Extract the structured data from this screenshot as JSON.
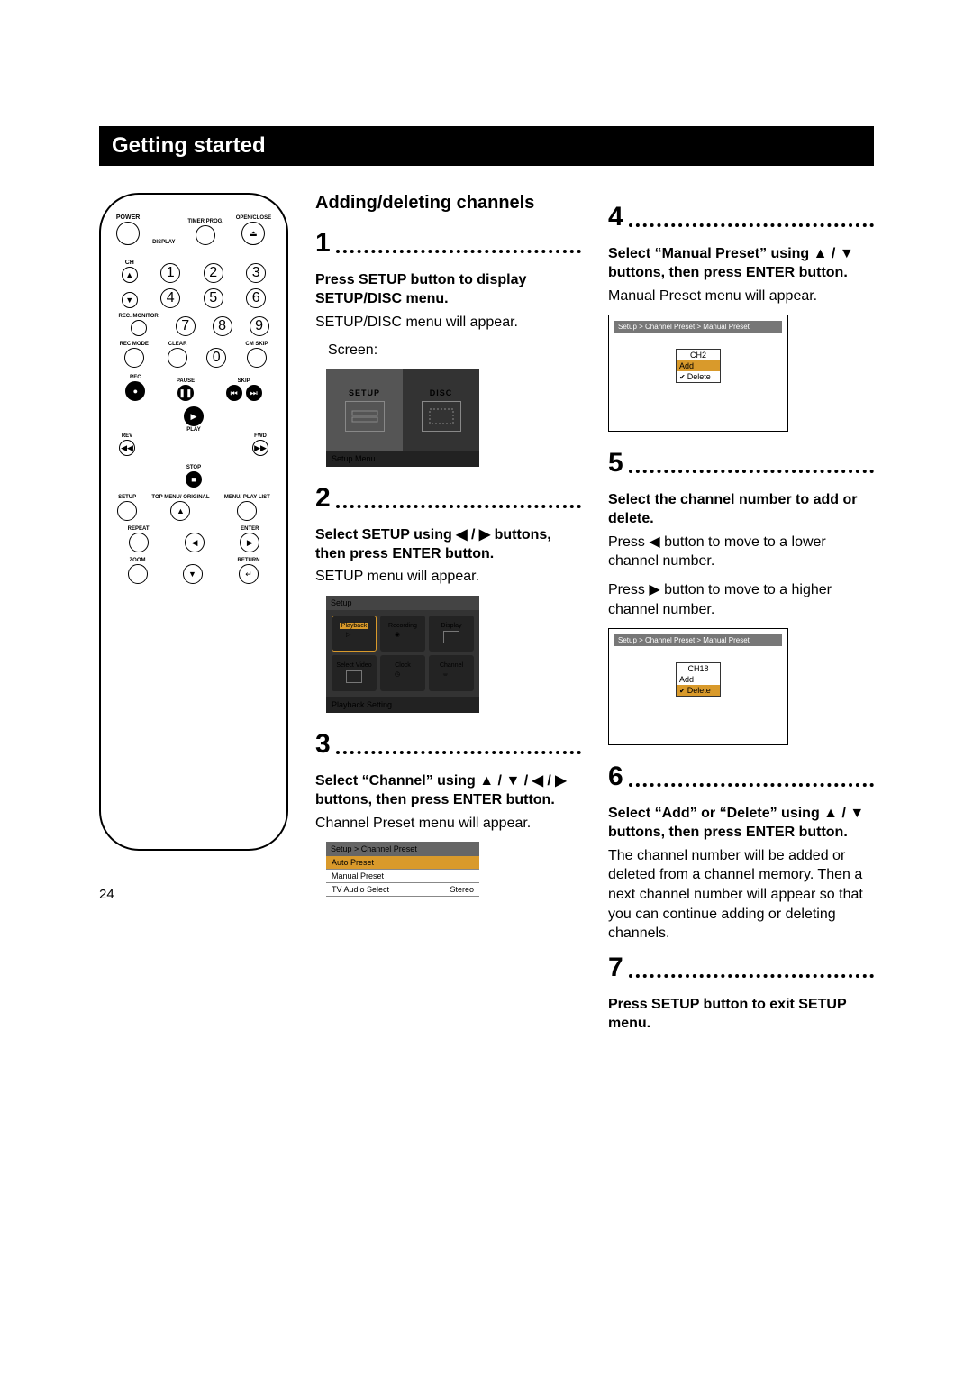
{
  "header": "Getting started",
  "section_title": "Adding/deleting channels",
  "pagenum": "24",
  "remote": {
    "power": "POWER",
    "display": "DISPLAY",
    "timer": "TIMER PROG.",
    "openclose": "OPEN/CLOSE",
    "ch": "CH",
    "rec_monitor": "REC. MONITOR",
    "rec_mode": "REC MODE",
    "clear": "CLEAR",
    "cm_skip": "CM SKIP",
    "rec": "REC",
    "pause": "PAUSE",
    "skip": "SKIP",
    "play": "PLAY",
    "rev": "REV",
    "fwd": "FWD",
    "stop": "STOP",
    "setup": "SETUP",
    "topmenu": "TOP MENU/ ORIGINAL",
    "menu": "MENU/ PLAY LIST",
    "repeat": "REPEAT",
    "enter": "ENTER",
    "zoom": "ZOOM",
    "return": "RETURN",
    "d1": "1",
    "d2": "2",
    "d3": "3",
    "d4": "4",
    "d5": "5",
    "d6": "6",
    "d7": "7",
    "d8": "8",
    "d9": "9",
    "d0": "0",
    "eject": "⏏"
  },
  "steps": {
    "s1": {
      "num": "1",
      "instr": "Press SETUP button to display SETUP/DISC menu.",
      "body": "SETUP/DISC menu will appear.",
      "screen_label": "Screen:",
      "screen": {
        "tab1": "SETUP",
        "tab2": "DISC",
        "foot": "Setup Menu"
      }
    },
    "s2": {
      "num": "2",
      "instr_pre": "Select SETUP using ",
      "instr_mid": " / ",
      "instr_post": " buttons, then press ENTER button.",
      "body": "SETUP menu will appear.",
      "screen": {
        "top": "Setup",
        "c1": "Playback",
        "c2": "Recording",
        "c3": "Display",
        "c4": "Select Video",
        "c5": "Clock",
        "c6": "Channel",
        "foot": "Playback Setting"
      }
    },
    "s3": {
      "num": "3",
      "instr_pre": "Select “Channel” using ",
      "instr_mid1": " / ",
      "instr_mid2": " / ",
      "instr_mid3": " / ",
      "instr_post": " buttons, then press ENTER button.",
      "body": "Channel Preset menu will appear.",
      "screen": {
        "crumb": "Setup > Channel Preset",
        "r1": "Auto Preset",
        "r2": "Manual Preset",
        "r3": "TV Audio Select",
        "r3v": "Stereo"
      }
    },
    "s4": {
      "num": "4",
      "instr_pre": "Select “Manual Preset” using ",
      "instr_mid": " / ",
      "instr_post": " buttons, then press ENTER button.",
      "body": "Manual Preset menu will appear.",
      "screen": {
        "crumb": "Setup > Channel Preset > Manual Preset",
        "ch": "CH2",
        "add": "Add",
        "del": "Delete"
      }
    },
    "s5": {
      "num": "5",
      "instr": "Select the channel number to add or delete.",
      "body1_pre": "Press ",
      "body1_post": " button to move to a lower channel number.",
      "body2_pre": "Press ",
      "body2_post": " button to move to a higher channel number.",
      "screen": {
        "crumb": "Setup > Channel Preset > Manual Preset",
        "ch": "CH18",
        "add": "Add",
        "del": "Delete"
      }
    },
    "s6": {
      "num": "6",
      "instr_pre": "Select “Add” or “Delete” using ",
      "instr_mid": " / ",
      "instr_post": " buttons, then press ENTER button.",
      "body": "The channel number will be added or deleted from a channel memory. Then a next channel number will appear so that you can continue adding or deleting channels."
    },
    "s7": {
      "num": "7",
      "instr": "Press SETUP button to exit SETUP menu."
    }
  },
  "arrows": {
    "left": "◀",
    "right": "▶",
    "up": "▲",
    "down": "▼",
    "leftb": "◀",
    "rightb": "▶",
    "upb": "▲",
    "downb": "▼"
  }
}
